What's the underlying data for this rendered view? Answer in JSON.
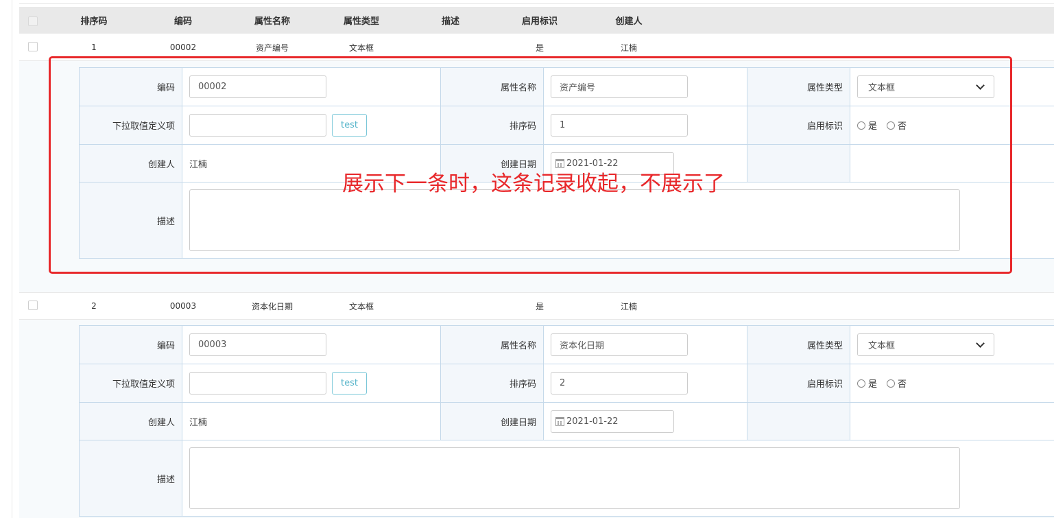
{
  "header": {
    "columns": [
      "排序码",
      "编码",
      "属性名称",
      "属性类型",
      "描述",
      "启用标识",
      "创建人"
    ]
  },
  "records": [
    {
      "row": {
        "sort": "1",
        "code": "00002",
        "name": "资产编号",
        "type": "文本框",
        "desc": "",
        "enabled": "是",
        "creator": "江楠"
      },
      "form": {
        "code_label": "编码",
        "code_value": "00002",
        "name_label": "属性名称",
        "name_value": "资产编号",
        "type_label": "属性类型",
        "type_value": "文本框",
        "dropdown_label": "下拉取值定义项",
        "dropdown_value": "",
        "test_button": "test",
        "sort_label": "排序码",
        "sort_value": "1",
        "enabled_label": "启用标识",
        "radio_yes": "是",
        "radio_no": "否",
        "creator_label": "创建人",
        "creator_value": "江楠",
        "date_label": "创建日期",
        "date_value": "2021-01-22",
        "desc_label": "描述",
        "desc_value": ""
      }
    },
    {
      "row": {
        "sort": "2",
        "code": "00003",
        "name": "资本化日期",
        "type": "文本框",
        "desc": "",
        "enabled": "是",
        "creator": "江楠"
      },
      "form": {
        "code_label": "编码",
        "code_value": "00003",
        "name_label": "属性名称",
        "name_value": "资本化日期",
        "type_label": "属性类型",
        "type_value": "文本框",
        "dropdown_label": "下拉取值定义项",
        "dropdown_value": "",
        "test_button": "test",
        "sort_label": "排序码",
        "sort_value": "2",
        "enabled_label": "启用标识",
        "radio_yes": "是",
        "radio_no": "否",
        "creator_label": "创建人",
        "creator_value": "江楠",
        "date_label": "创建日期",
        "date_value": "2021-01-22",
        "desc_label": "描述",
        "desc_value": ""
      }
    }
  ],
  "annotation": {
    "text": "展示下一条时，这条记录收起，不展示了",
    "color": "#e8282b"
  },
  "colors": {
    "header_bg": "#e9e9e9",
    "form_border": "#c5d9ea",
    "label_bg": "#f3f7fb",
    "test_button": "#5ab6cb"
  }
}
